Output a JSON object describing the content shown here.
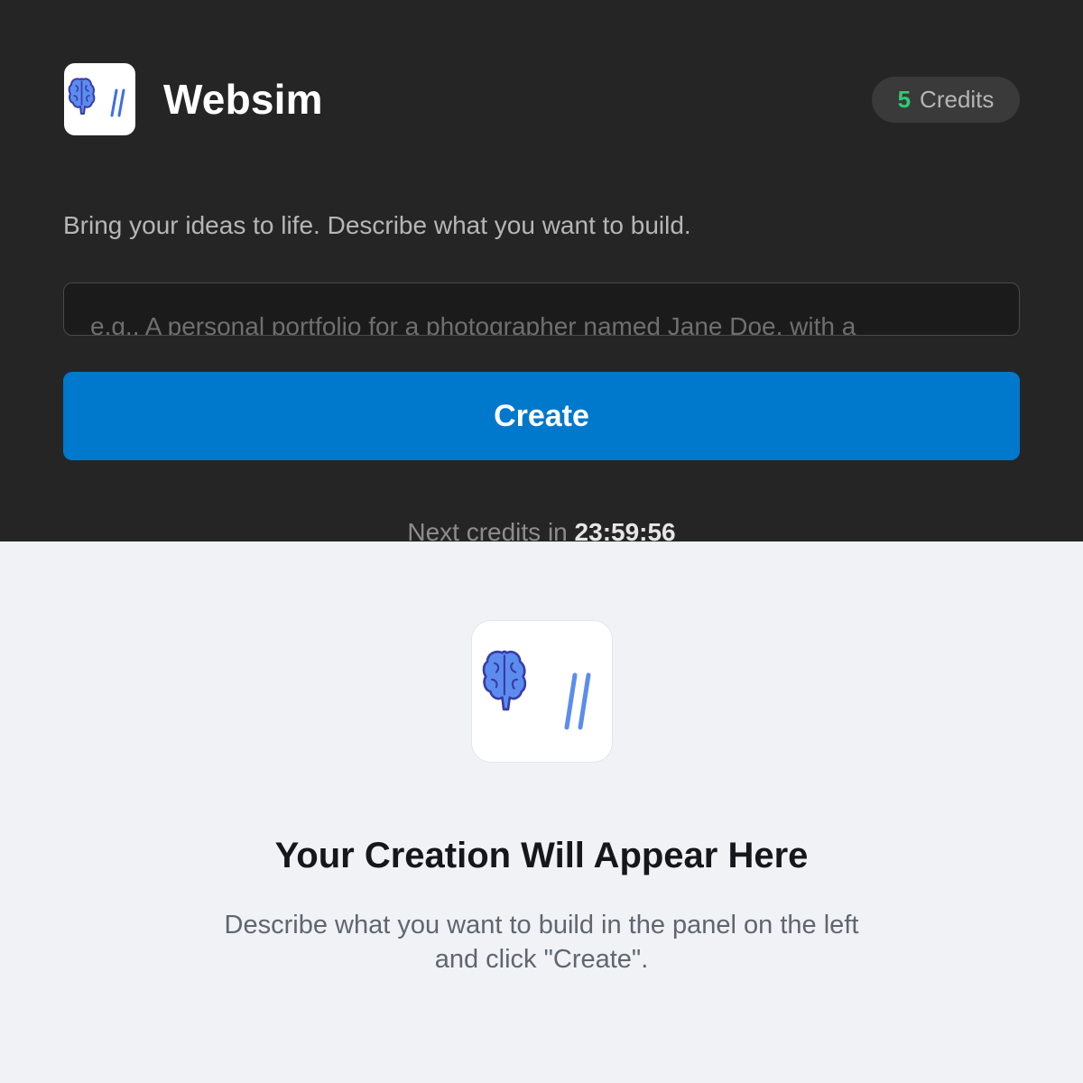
{
  "header": {
    "app_title": "Websim",
    "logo_icon": "brain-slash-logo-icon"
  },
  "credits": {
    "count": "5",
    "label": "Credits",
    "count_color": "#2ecc71"
  },
  "prompt": {
    "tagline": "Bring your ideas to life. Describe what you want to build.",
    "placeholder": "e.g., A personal portfolio for a photographer named Jane Doe, with a",
    "value": ""
  },
  "create_button": {
    "label": "Create",
    "color": "#0078cc"
  },
  "next_credits": {
    "label": "Next credits in",
    "time": "23:59:56"
  },
  "preview": {
    "title": "Your Creation Will Appear Here",
    "description_line1": "Describe what you want to build in the panel on the left",
    "description_line2": "and click \"Create\"."
  },
  "colors": {
    "top_panel_bg": "#252525",
    "bottom_panel_bg": "#f0f2f6",
    "brain_fill": "#5b8def",
    "brain_stroke": "#3b3ba8",
    "slash_color": "#3d6fe0"
  }
}
